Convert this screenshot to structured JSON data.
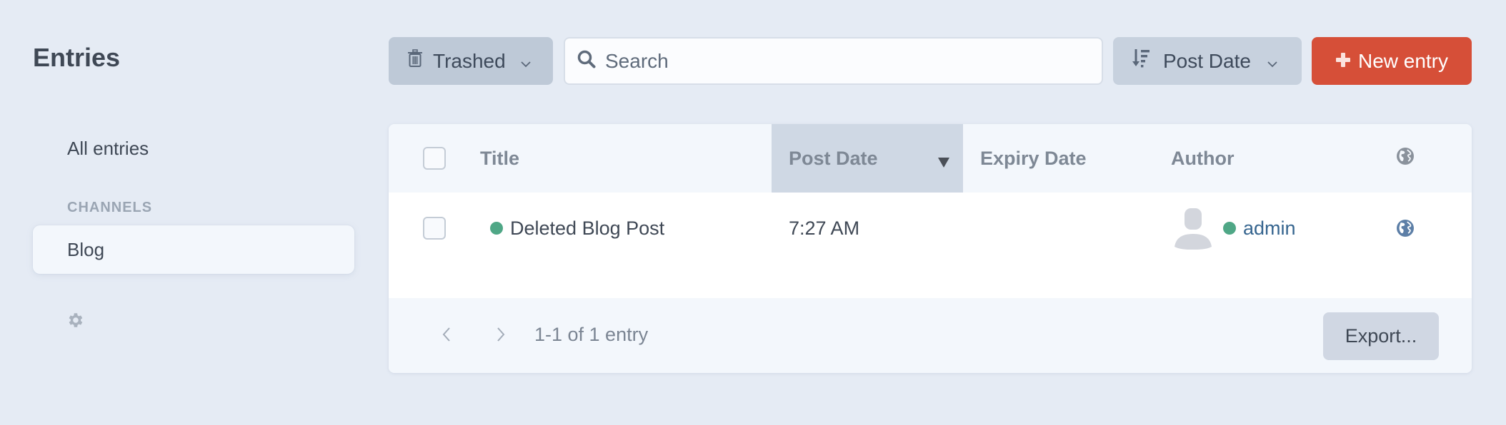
{
  "sidebar": {
    "title": "Entries",
    "all_entries": "All entries",
    "channels_heading": "CHANNELS",
    "channels": [
      {
        "label": "Blog",
        "active": true
      }
    ],
    "settings_icon": "gear-icon"
  },
  "toolbar": {
    "status_filter": {
      "label": "Trashed",
      "icon": "trash-icon"
    },
    "search": {
      "placeholder": "Search",
      "value": "",
      "icon": "search-icon"
    },
    "sort": {
      "label": "Post Date",
      "icon": "sort-descending-icon"
    },
    "new_entry": {
      "label": "New entry",
      "icon": "plus-icon"
    }
  },
  "table": {
    "columns": [
      {
        "label": "Title"
      },
      {
        "label": "Post Date",
        "sorted": true,
        "sort_direction": "desc"
      },
      {
        "label": "Expiry Date"
      },
      {
        "label": "Author"
      },
      {
        "label": "",
        "icon": "globe-icon"
      }
    ],
    "rows": [
      {
        "title": "Deleted Blog Post",
        "status_color": "#4fa786",
        "post_date": "7:27 AM",
        "expiry_date": "",
        "author": "admin",
        "author_status_color": "#4fa786",
        "site_icon": "globe-icon"
      }
    ],
    "pagination": {
      "summary": "1-1 of 1 entry"
    },
    "export_label": "Export..."
  },
  "colors": {
    "accent": "#d64f38",
    "status_enabled": "#4fa786",
    "link": "#36658f",
    "background": "#e5ebf4"
  }
}
